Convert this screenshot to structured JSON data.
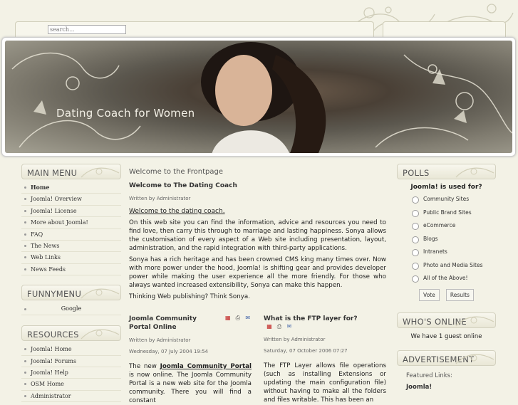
{
  "search": {
    "placeholder": "search..."
  },
  "banner": {
    "title": "Dating Coach for Women"
  },
  "main_menu": {
    "title": "MAIN MENU",
    "items": [
      "Home",
      "Joomla! Overview",
      "Joomla! License",
      "More about Joomla!",
      "FAQ",
      "The News",
      "Web Links",
      "News Feeds"
    ]
  },
  "funny_menu": {
    "title": "FUNNYMENU",
    "items": [
      "Google"
    ]
  },
  "resources": {
    "title": "RESOURCES",
    "items": [
      "Joomla! Home",
      "Joomla! Forums",
      "Joomla! Help",
      "OSM Home",
      "Administrator"
    ]
  },
  "content": {
    "page_title": "Welcome to the Frontpage",
    "article": {
      "title": "Welcome to The Dating Coach",
      "meta": "Written by Administrator",
      "intro": "Welcome to the dating coach.",
      "p1": "On this web site you can find the information, advice and resources you need to find love, then carry this through to marriage and lasting happiness. Sonya allows the customisation of every aspect of a Web site including presentation, layout, administration, and the rapid integration with third-party applications.",
      "p2": "Sonya has a rich heritage and has been crowned CMS king many times over. Now with more power under the hood, Joomla! is shifting gear and provides developer power while making the user experience all the more friendly. For those who always wanted increased extensibility, Sonya can make this happen.",
      "p3": "Thinking Web publishing? Think Sonya."
    },
    "sub1": {
      "title": "Joomla Community Portal Online",
      "meta": "Written by Administrator",
      "date": "Wednesday, 07 July 2004 19:54",
      "text_a": "The new ",
      "link": "Joomla Community Portal",
      "text_b": " is now online. The Joomla Community Portal is a new web site for the Joomla community. There you will find a constant"
    },
    "sub2": {
      "title": "What is the FTP layer for?",
      "meta": "Written by Administrator",
      "date": "Saturday, 07 October 2006 07:27",
      "text": "The FTP Layer allows file operations (such as installing Extensions or updating the main configuration file) without having to make all the folders and files writable. This has been an"
    }
  },
  "polls": {
    "title": "POLLS",
    "question": "Joomla! is used for?",
    "options": [
      "Community Sites",
      "Public Brand Sites",
      "eCommerce",
      "Blogs",
      "Intranets",
      "Photo and Media Sites",
      "All of the Above!"
    ],
    "vote_label": "Vote",
    "results_label": "Results"
  },
  "whos_online": {
    "title": "WHO'S ONLINE",
    "text": "We have 1 guest online"
  },
  "advertisement": {
    "title": "ADVERTISEMENT",
    "featured": "Featured Links:",
    "first": "Joomla!"
  },
  "icons": {
    "pdf": "pdf-icon",
    "print": "print-icon",
    "email": "email-icon"
  }
}
